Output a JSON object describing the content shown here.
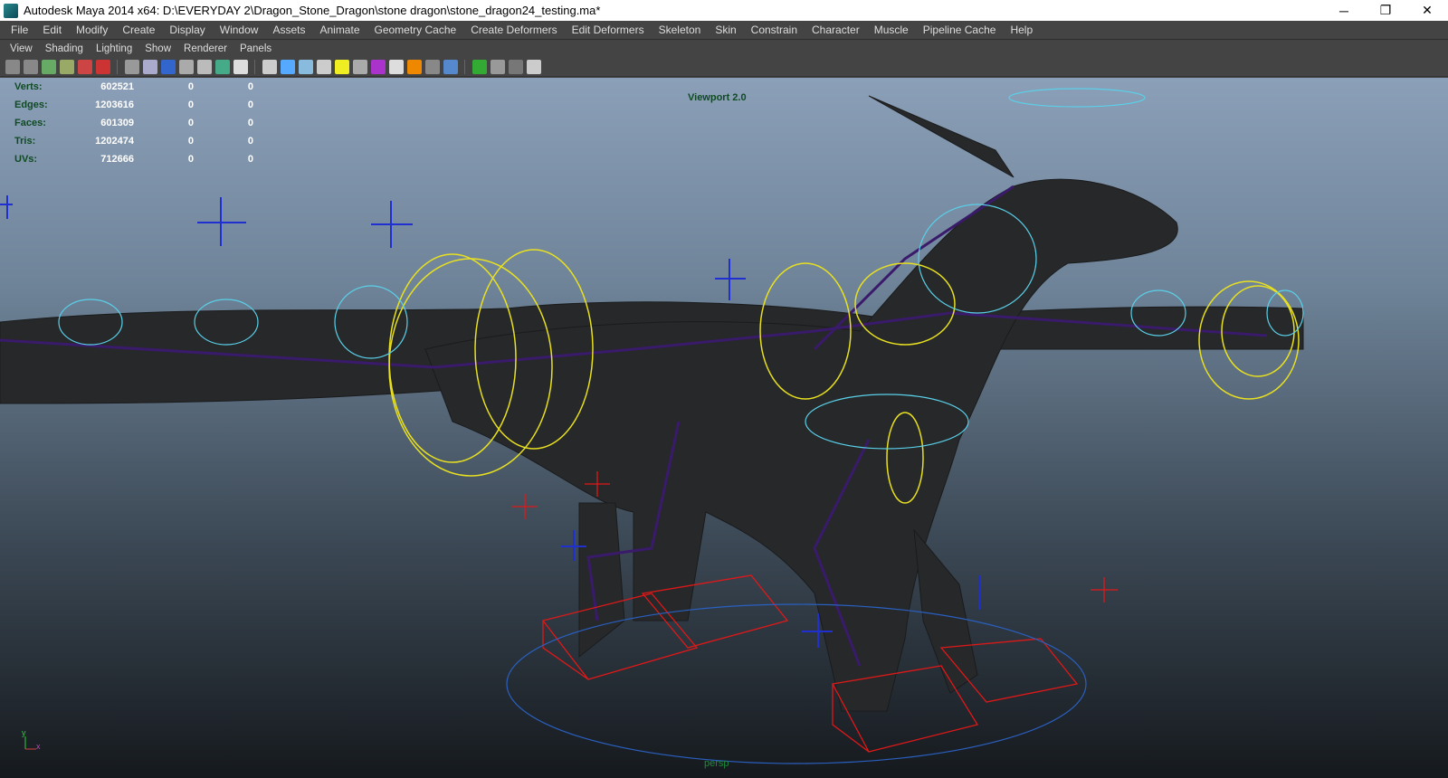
{
  "window": {
    "title": "Autodesk Maya 2014 x64: D:\\EVERYDAY 2\\Dragon_Stone_Dragon\\stone dragon\\stone_dragon24_testing.ma*",
    "minimize": "─",
    "restore": "❐",
    "close": "✕"
  },
  "menu": [
    "File",
    "Edit",
    "Modify",
    "Create",
    "Display",
    "Window",
    "Assets",
    "Animate",
    "Geometry Cache",
    "Create Deformers",
    "Edit Deformers",
    "Skeleton",
    "Skin",
    "Constrain",
    "Character",
    "Muscle",
    "Pipeline Cache",
    "Help"
  ],
  "panel_menu": [
    "View",
    "Shading",
    "Lighting",
    "Show",
    "Renderer",
    "Panels"
  ],
  "toolbar_icons": [
    "camera-icon",
    "camera-attr-icon",
    "bookmark-icon",
    "image-plane-icon",
    "2d-pan-icon",
    "grease-pencil-icon",
    "grid-icon",
    "film-gate-icon",
    "resolution-gate-icon",
    "gate-mask-icon",
    "field-chart-icon",
    "safe-action-icon",
    "safe-title-icon",
    "wireframe-icon",
    "smooth-shade-icon",
    "wireframe-on-shaded-icon",
    "textured-icon",
    "use-all-lights-icon",
    "shadows-icon",
    "high-quality-icon",
    "ambient-occlusion-icon",
    "motion-blur-icon",
    "multisample-icon",
    "anti-alias-icon",
    "isolate-select-icon",
    "xray-icon",
    "xray-active-icon",
    "xray-joints-icon"
  ],
  "stats": {
    "rows": [
      {
        "label": "Verts:",
        "value": "602521",
        "a": "0",
        "b": "0"
      },
      {
        "label": "Edges:",
        "value": "1203616",
        "a": "0",
        "b": "0"
      },
      {
        "label": "Faces:",
        "value": "601309",
        "a": "0",
        "b": "0"
      },
      {
        "label": "Tris:",
        "value": "1202474",
        "a": "0",
        "b": "0"
      },
      {
        "label": "UVs:",
        "value": "712666",
        "a": "0",
        "b": "0"
      }
    ]
  },
  "viewport": {
    "renderer_label": "Viewport 2.0",
    "camera_label": "persp",
    "axis_y": "y",
    "axis_x": "x"
  },
  "colors": {
    "stats_label": "#0f4a22",
    "controls_yellow": "#e8e020",
    "controls_cyan": "#5ad0e8",
    "joints": "#3a1a6a",
    "ik_red": "#e01818",
    "locator_blue": "#2030d0"
  }
}
